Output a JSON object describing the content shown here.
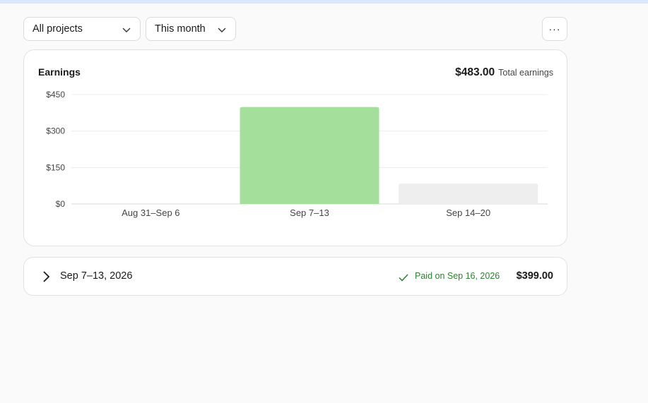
{
  "filters": {
    "project": "All projects",
    "period": "This month"
  },
  "more_label": "···",
  "earnings": {
    "title": "Earnings",
    "total_amount": "$483.00",
    "total_label": "Total earnings"
  },
  "chart_data": {
    "type": "bar",
    "categories": [
      "Aug 31–Sep 6",
      "Sep 7–13",
      "Sep 14–20"
    ],
    "values": [
      0,
      399,
      84
    ],
    "y_ticks": [
      "$0",
      "$150",
      "$300",
      "$450"
    ],
    "y_tick_values": [
      0,
      150,
      300,
      450
    ],
    "ylim": [
      0,
      450
    ],
    "grid": true,
    "colors": [
      "#a4df9c",
      "#a4df9c",
      "#eeeeee"
    ]
  },
  "payouts": [
    {
      "period": "Sep 7–13, 2026",
      "status": "Paid on Sep 16, 2026",
      "amount": "$399.00"
    }
  ],
  "colors": {
    "paid_green": "#2e7d32",
    "bar_paid": "#a4df9c",
    "bar_pending": "#eeeeee"
  }
}
